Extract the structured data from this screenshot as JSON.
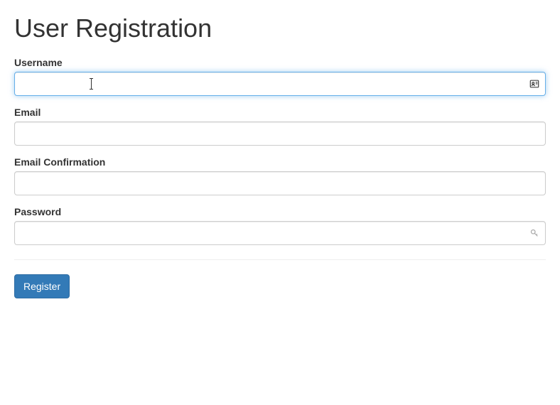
{
  "page_title": "User Registration",
  "fields": {
    "username": {
      "label": "Username",
      "value": ""
    },
    "email": {
      "label": "Email",
      "value": ""
    },
    "email_confirm": {
      "label": "Email Confirmation",
      "value": ""
    },
    "password": {
      "label": "Password",
      "value": ""
    }
  },
  "submit_label": "Register",
  "icons": {
    "username_suggest": "contact-card-icon",
    "password_key": "key-icon"
  }
}
